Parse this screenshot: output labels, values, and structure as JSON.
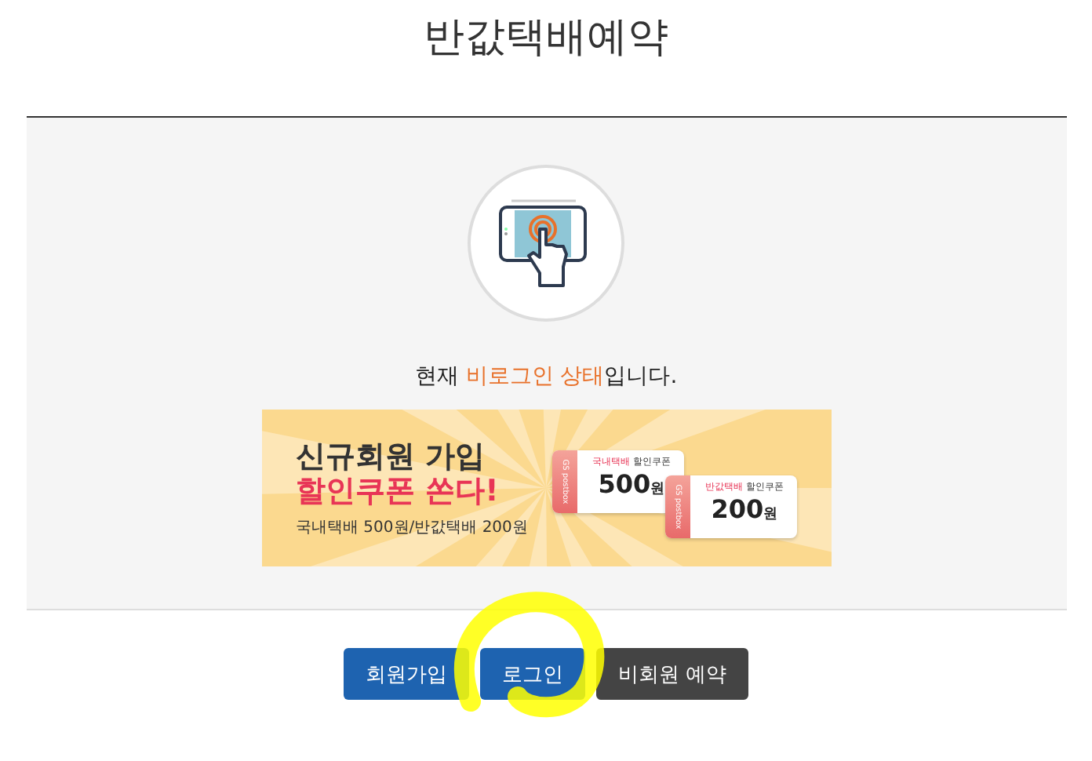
{
  "page": {
    "title": "반값택배예약"
  },
  "status": {
    "parts": [
      {
        "text": "현재 ",
        "emphasis": false
      },
      {
        "text": "비로그인 상태",
        "emphasis": true
      },
      {
        "text": "입니다.",
        "emphasis": false
      }
    ]
  },
  "banner": {
    "headline": "신규회원 가입",
    "slogan": "할인쿠폰 쏜다!",
    "subtext": "국내택배 500원/반값택배 200원",
    "coupons": [
      {
        "brand": "GS postbox",
        "service": "국내택배",
        "label": "할인쿠폰",
        "amount": "500",
        "unit": "원"
      },
      {
        "brand": "GS postbox",
        "service": "반값택배",
        "label": "할인쿠폰",
        "amount": "200",
        "unit": "원"
      }
    ]
  },
  "buttons": [
    {
      "label": "회원가입",
      "kind": "primary"
    },
    {
      "label": "로그인",
      "kind": "primary"
    },
    {
      "label": "비회원 예약",
      "kind": "dark"
    }
  ]
}
